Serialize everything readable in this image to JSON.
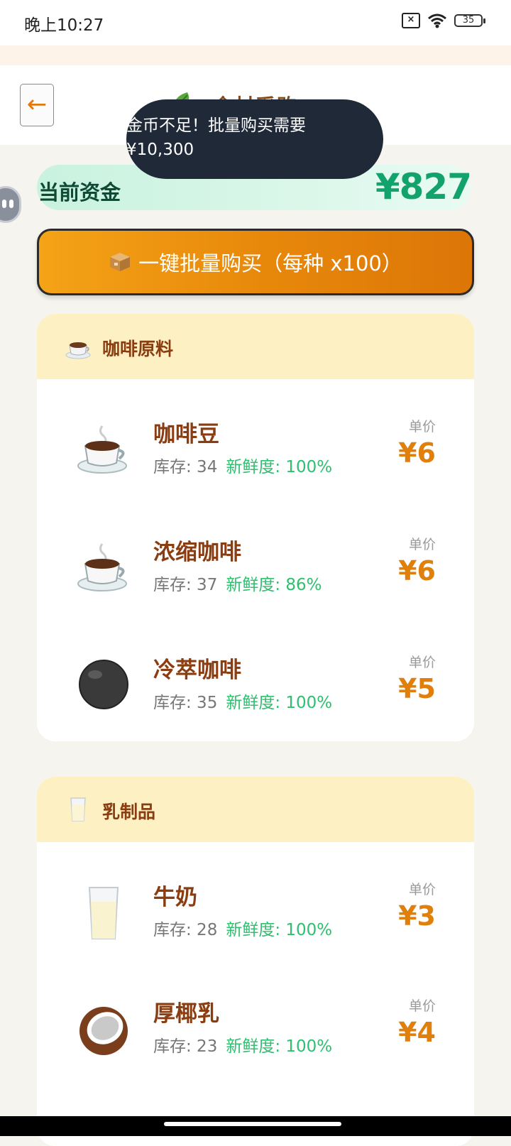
{
  "status_bar": {
    "time": "晚上10:27",
    "battery": "35"
  },
  "header": {
    "title": "食材采购",
    "back_label": "←"
  },
  "toast": {
    "message": "金币不足！批量购买需要¥10,300"
  },
  "funds": {
    "label": "当前资金",
    "value": "¥827"
  },
  "bulk_buy": {
    "label": "一键批量购买（每种 x100）"
  },
  "categories": [
    {
      "title": "咖啡原料",
      "icon": "coffee-cup-icon",
      "items": [
        {
          "name": "咖啡豆",
          "icon": "coffee-cup-icon",
          "stock": "库存: 34",
          "freshness": "新鲜度: 100%",
          "price_label": "单价",
          "price": "¥6"
        },
        {
          "name": "浓缩咖啡",
          "icon": "coffee-cup-icon",
          "stock": "库存: 37",
          "freshness": "新鲜度: 86%",
          "price_label": "单价",
          "price": "¥6"
        },
        {
          "name": "冷萃咖啡",
          "icon": "black-circle-icon",
          "stock": "库存: 35",
          "freshness": "新鲜度: 100%",
          "price_label": "单价",
          "price": "¥5"
        }
      ]
    },
    {
      "title": "乳制品",
      "icon": "milk-glass-icon",
      "items": [
        {
          "name": "牛奶",
          "icon": "milk-glass-icon",
          "stock": "库存: 28",
          "freshness": "新鲜度: 100%",
          "price_label": "单价",
          "price": "¥3"
        },
        {
          "name": "厚椰乳",
          "icon": "coconut-icon",
          "stock": "库存: 23",
          "freshness": "新鲜度: 100%",
          "price_label": "单价",
          "price": "¥4"
        }
      ]
    }
  ],
  "colors": {
    "accent": "#e07f0a",
    "fresh": "#2fbf6f",
    "funds": "#11a36b",
    "toast_bg": "#1f2937"
  }
}
